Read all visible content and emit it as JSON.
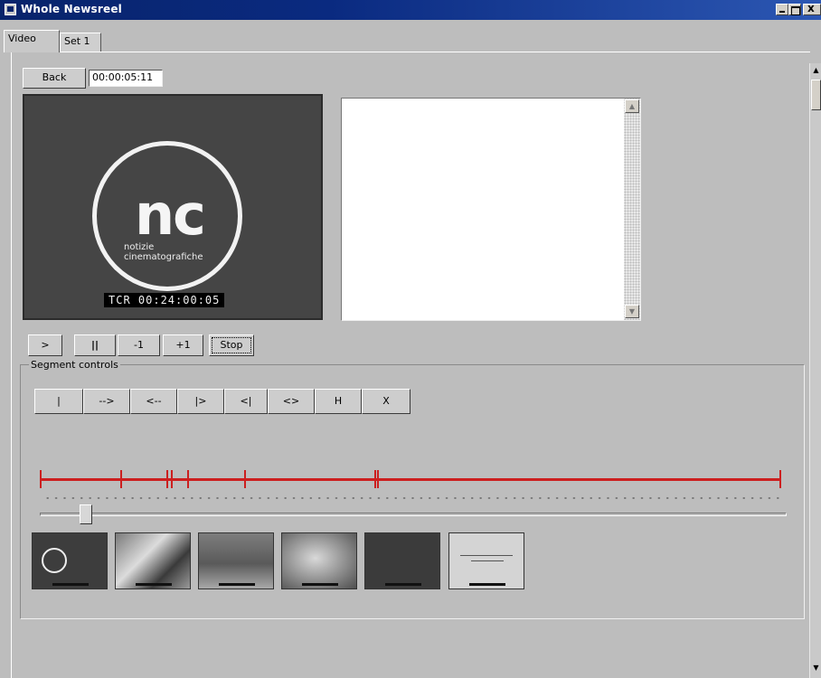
{
  "window": {
    "title": "Whole Newsreel"
  },
  "tabs": [
    {
      "label": "Video"
    },
    {
      "label": "Set 1"
    }
  ],
  "toolbar": {
    "back_label": "Back",
    "timecode_value": "00:00:05:11"
  },
  "video_frame": {
    "logo_text": "nc",
    "logo_line1": "notizie",
    "logo_line2": "cinematografiche",
    "tcr_overlay": "TCR 00:24:00:05"
  },
  "transport": [
    {
      "label": ">"
    },
    {
      "label": "||"
    },
    {
      "label": "-1"
    },
    {
      "label": "+1"
    },
    {
      "label": "Stop"
    }
  ],
  "segment_controls": {
    "label": "Segment controls",
    "buttons": [
      {
        "label": "|"
      },
      {
        "label": "-->"
      },
      {
        "label": "<--"
      },
      {
        "label": "|>"
      },
      {
        "label": "<|"
      },
      {
        "label": "<>"
      },
      {
        "label": "H"
      },
      {
        "label": "X"
      }
    ]
  },
  "slider": {
    "position_fraction": 0.06
  },
  "thumbnails_count": 6,
  "colors": {
    "accent": "#cc1f1f",
    "titlebar": "#08246b",
    "panel": "#bdbdbd"
  }
}
